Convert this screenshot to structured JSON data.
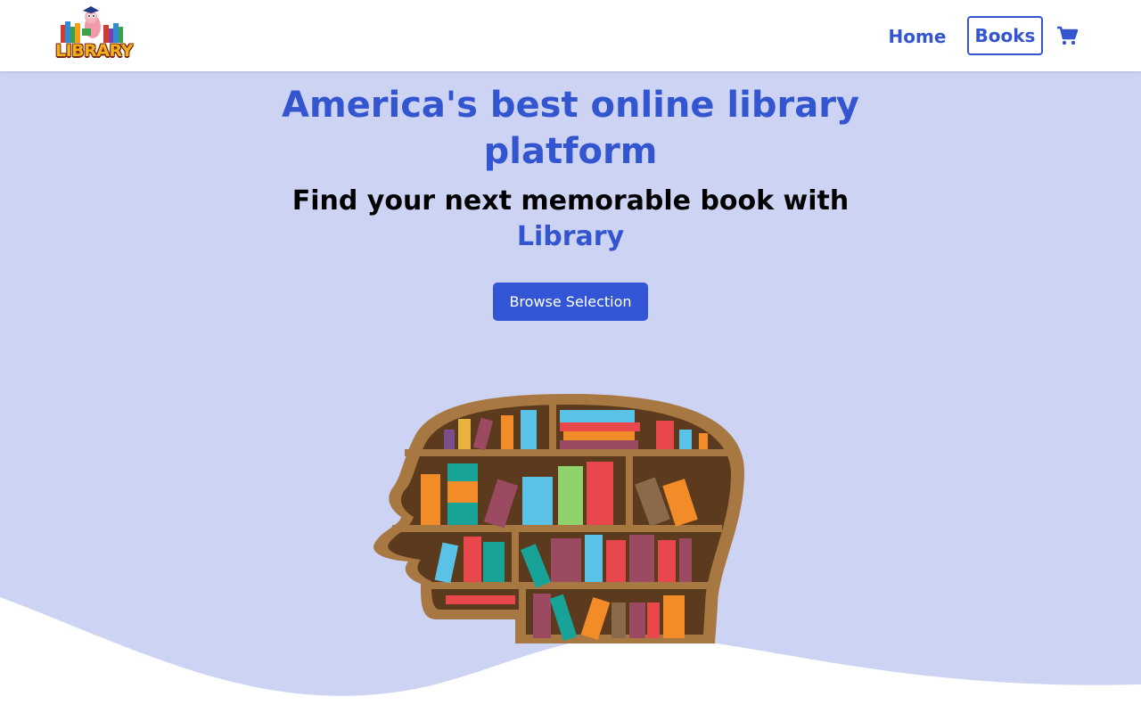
{
  "logo": {
    "text": "LIBRARY"
  },
  "nav": {
    "home_label": "Home",
    "books_label": "Books",
    "cart_icon": "cart-icon"
  },
  "hero": {
    "title": "America's best online library platform",
    "subtitle": "Find your next memorable book with",
    "brand": "Library",
    "button_label": "Browse Selection"
  },
  "colors": {
    "accent": "#3355cf",
    "hero_bg": "#cdd3f3",
    "button_bg": "#3356d6",
    "shelf_wood": "#a87842"
  }
}
